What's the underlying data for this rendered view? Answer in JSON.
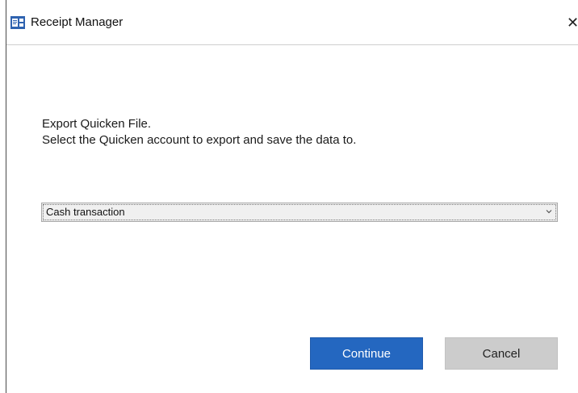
{
  "window": {
    "title": "Receipt Manager",
    "close_glyph": "✕"
  },
  "icons": {
    "app": "receipt-manager-app-icon",
    "close": "close-icon",
    "dropdown": "chevron-down-icon"
  },
  "message": {
    "line1": "Export Quicken File.",
    "line2": "Select the Quicken account to export and save the data to."
  },
  "account_select": {
    "selected": "Cash transaction"
  },
  "buttons": {
    "continue_label": "Continue",
    "cancel_label": "Cancel"
  },
  "colors": {
    "primary": "#2467c0",
    "secondary": "#cccccc"
  }
}
